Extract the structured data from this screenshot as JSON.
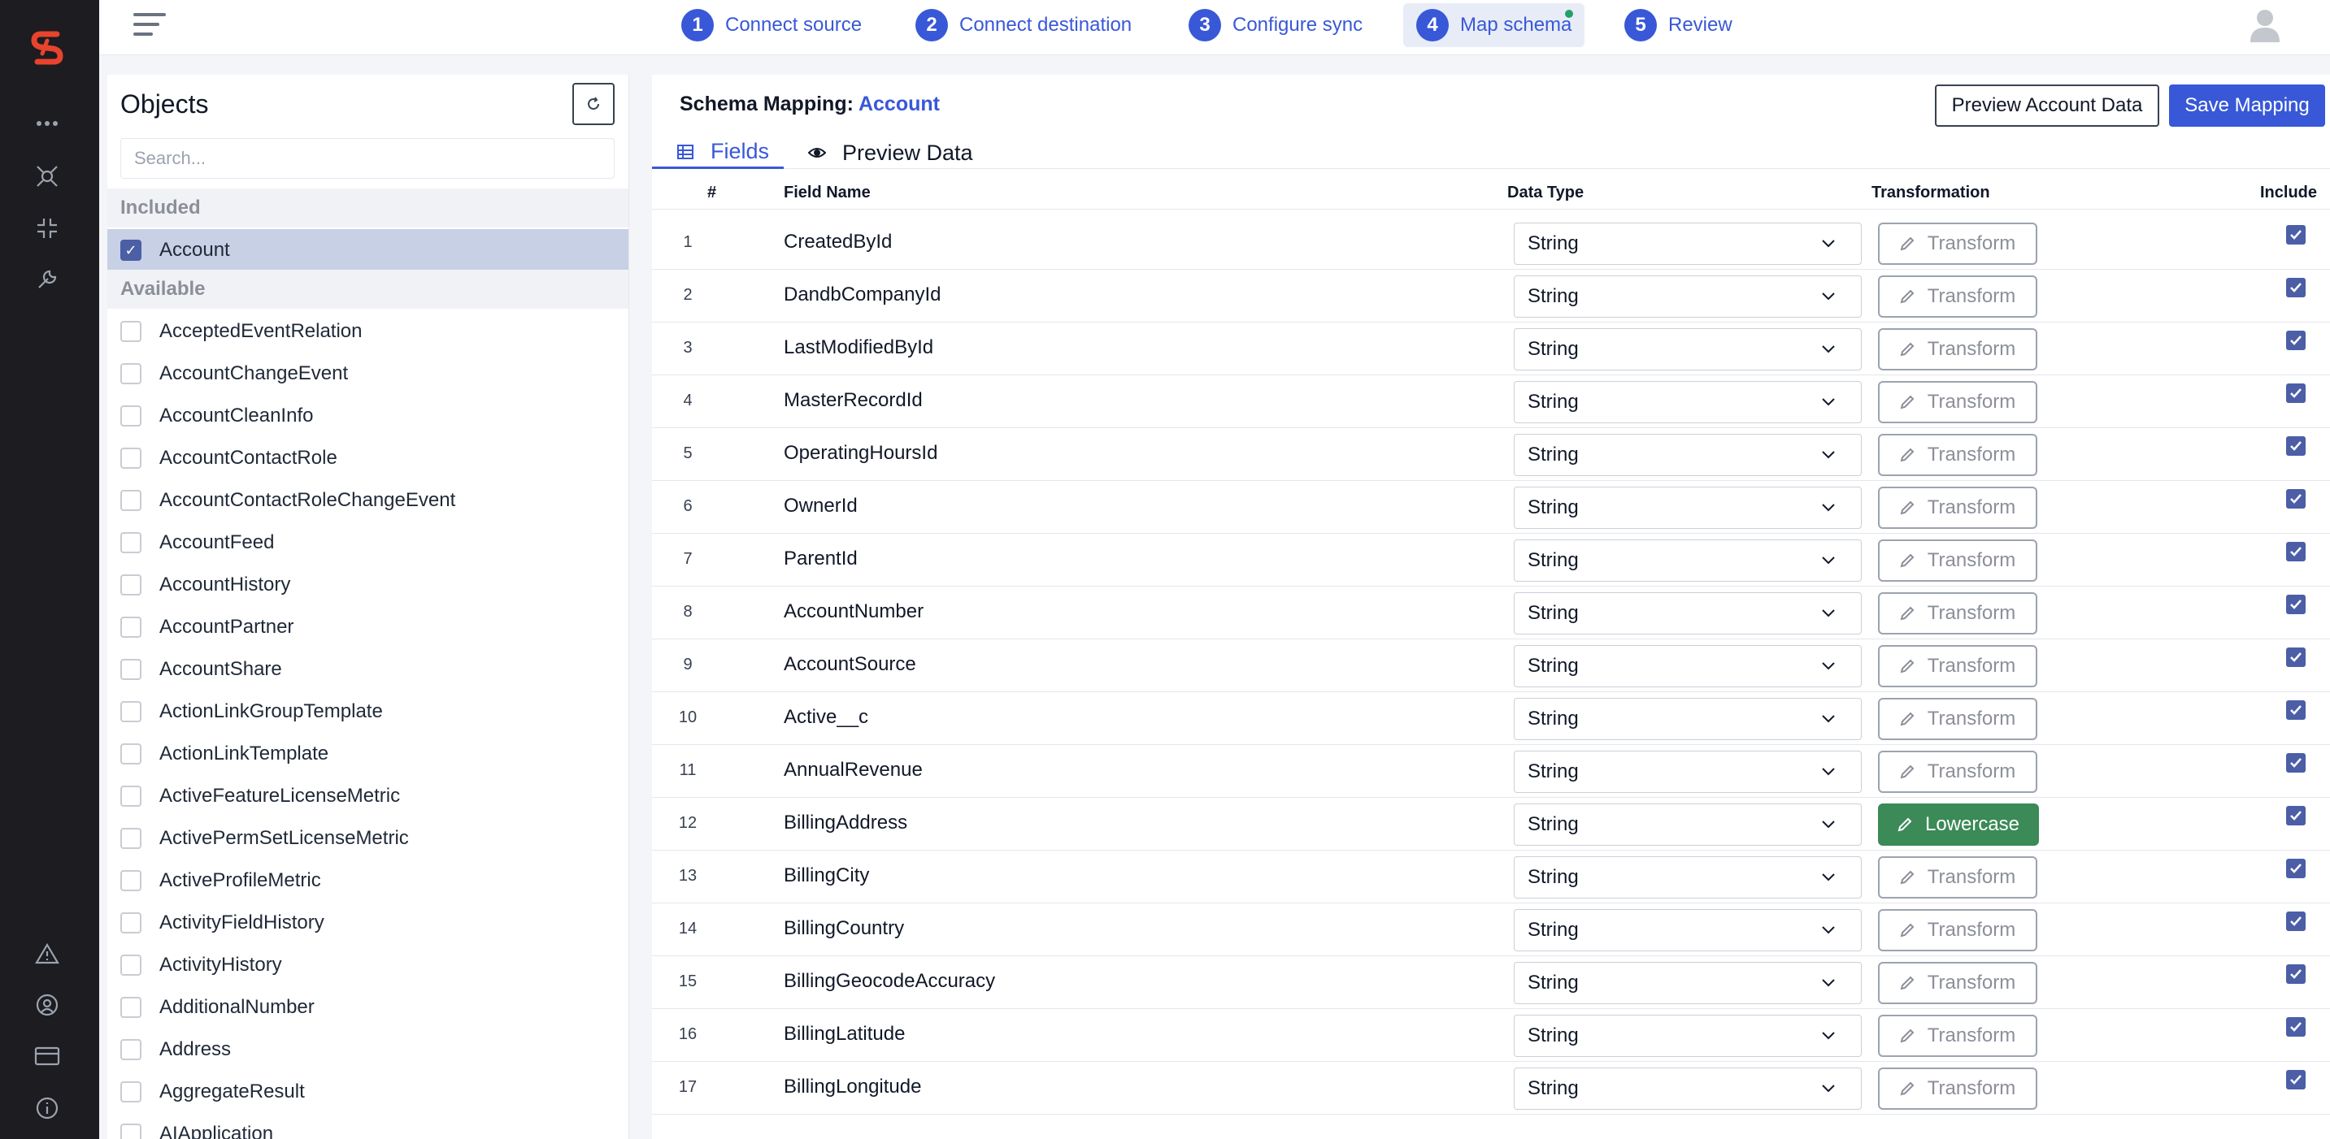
{
  "steps": [
    {
      "num": "1",
      "label": "Connect source"
    },
    {
      "num": "2",
      "label": "Connect destination"
    },
    {
      "num": "3",
      "label": "Configure sync"
    },
    {
      "num": "4",
      "label": "Map schema"
    },
    {
      "num": "5",
      "label": "Review"
    }
  ],
  "active_step": 4,
  "objects": {
    "title": "Objects",
    "search_placeholder": "Search...",
    "included_label": "Included",
    "available_label": "Available",
    "included": [
      "Account"
    ],
    "available": [
      "AcceptedEventRelation",
      "AccountChangeEvent",
      "AccountCleanInfo",
      "AccountContactRole",
      "AccountContactRoleChangeEvent",
      "AccountFeed",
      "AccountHistory",
      "AccountPartner",
      "AccountShare",
      "ActionLinkGroupTemplate",
      "ActionLinkTemplate",
      "ActiveFeatureLicenseMetric",
      "ActivePermSetLicenseMetric",
      "ActiveProfileMetric",
      "ActivityFieldHistory",
      "ActivityHistory",
      "AdditionalNumber",
      "Address",
      "AggregateResult",
      "AIApplication"
    ]
  },
  "mapping": {
    "title_prefix": "Schema Mapping:",
    "object_name": "Account",
    "preview_button": "Preview Account Data",
    "save_button": "Save Mapping",
    "tabs": [
      "Fields",
      "Preview Data"
    ],
    "columns": {
      "num": "#",
      "field": "Field Name",
      "type": "Data Type",
      "transform": "Transformation",
      "include": "Include"
    },
    "rows": [
      {
        "num": "1",
        "field": "CreatedById",
        "type": "String",
        "transform": "Transform",
        "applied": false
      },
      {
        "num": "2",
        "field": "DandbCompanyId",
        "type": "String",
        "transform": "Transform",
        "applied": false
      },
      {
        "num": "3",
        "field": "LastModifiedById",
        "type": "String",
        "transform": "Transform",
        "applied": false
      },
      {
        "num": "4",
        "field": "MasterRecordId",
        "type": "String",
        "transform": "Transform",
        "applied": false
      },
      {
        "num": "5",
        "field": "OperatingHoursId",
        "type": "String",
        "transform": "Transform",
        "applied": false
      },
      {
        "num": "6",
        "field": "OwnerId",
        "type": "String",
        "transform": "Transform",
        "applied": false
      },
      {
        "num": "7",
        "field": "ParentId",
        "type": "String",
        "transform": "Transform",
        "applied": false
      },
      {
        "num": "8",
        "field": "AccountNumber",
        "type": "String",
        "transform": "Transform",
        "applied": false
      },
      {
        "num": "9",
        "field": "AccountSource",
        "type": "String",
        "transform": "Transform",
        "applied": false
      },
      {
        "num": "10",
        "field": "Active__c",
        "type": "String",
        "transform": "Transform",
        "applied": false
      },
      {
        "num": "11",
        "field": "AnnualRevenue",
        "type": "String",
        "transform": "Transform",
        "applied": false
      },
      {
        "num": "12",
        "field": "BillingAddress",
        "type": "String",
        "transform": "Lowercase",
        "applied": true
      },
      {
        "num": "13",
        "field": "BillingCity",
        "type": "String",
        "transform": "Transform",
        "applied": false
      },
      {
        "num": "14",
        "field": "BillingCountry",
        "type": "String",
        "transform": "Transform",
        "applied": false
      },
      {
        "num": "15",
        "field": "BillingGeocodeAccuracy",
        "type": "String",
        "transform": "Transform",
        "applied": false
      },
      {
        "num": "16",
        "field": "BillingLatitude",
        "type": "String",
        "transform": "Transform",
        "applied": false
      },
      {
        "num": "17",
        "field": "BillingLongitude",
        "type": "String",
        "transform": "Transform",
        "applied": false
      }
    ]
  },
  "colors": {
    "accent": "#3858d8",
    "applied": "#3b8a57",
    "rail": "#1c1c21",
    "brand": "#e8432d"
  }
}
